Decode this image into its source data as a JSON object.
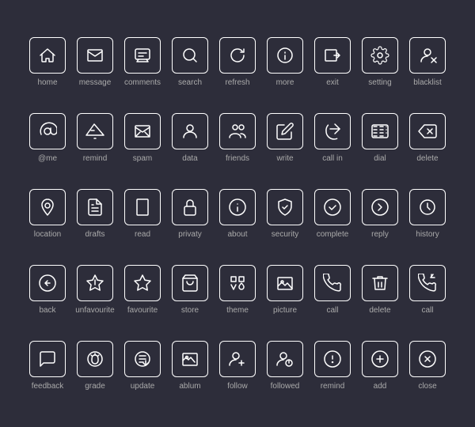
{
  "icons": [
    {
      "name": "home",
      "label": "home"
    },
    {
      "name": "message",
      "label": "message"
    },
    {
      "name": "comments",
      "label": "comments"
    },
    {
      "name": "search",
      "label": "search"
    },
    {
      "name": "refresh",
      "label": "refresh"
    },
    {
      "name": "more",
      "label": "more"
    },
    {
      "name": "exit",
      "label": "exit"
    },
    {
      "name": "setting",
      "label": "setting"
    },
    {
      "name": "blacklist",
      "label": "blacklist"
    },
    {
      "name": "at-me",
      "label": "@me"
    },
    {
      "name": "remind",
      "label": "remind"
    },
    {
      "name": "spam",
      "label": "spam"
    },
    {
      "name": "data",
      "label": "data"
    },
    {
      "name": "friends",
      "label": "friends"
    },
    {
      "name": "write",
      "label": "write"
    },
    {
      "name": "call-in",
      "label": "call in"
    },
    {
      "name": "dial",
      "label": "dial"
    },
    {
      "name": "delete",
      "label": "delete"
    },
    {
      "name": "location",
      "label": "location"
    },
    {
      "name": "drafts",
      "label": "drafts"
    },
    {
      "name": "read",
      "label": "read"
    },
    {
      "name": "privacy",
      "label": "privaty"
    },
    {
      "name": "about",
      "label": "about"
    },
    {
      "name": "security",
      "label": "security"
    },
    {
      "name": "complete",
      "label": "complete"
    },
    {
      "name": "reply",
      "label": "reply"
    },
    {
      "name": "history",
      "label": "history"
    },
    {
      "name": "back",
      "label": "back"
    },
    {
      "name": "unfavourite",
      "label": "unfavourite"
    },
    {
      "name": "favourite",
      "label": "favourite"
    },
    {
      "name": "store",
      "label": "store"
    },
    {
      "name": "theme",
      "label": "theme"
    },
    {
      "name": "picture",
      "label": "picture"
    },
    {
      "name": "call",
      "label": "call"
    },
    {
      "name": "delete2",
      "label": "delete"
    },
    {
      "name": "call2",
      "label": "call"
    },
    {
      "name": "feedback",
      "label": "feedback"
    },
    {
      "name": "grade",
      "label": "grade"
    },
    {
      "name": "update",
      "label": "update"
    },
    {
      "name": "ablum",
      "label": "ablum"
    },
    {
      "name": "follow",
      "label": "follow"
    },
    {
      "name": "followed",
      "label": "followed"
    },
    {
      "name": "remind2",
      "label": "remind"
    },
    {
      "name": "add",
      "label": "add"
    },
    {
      "name": "close",
      "label": "close"
    }
  ]
}
